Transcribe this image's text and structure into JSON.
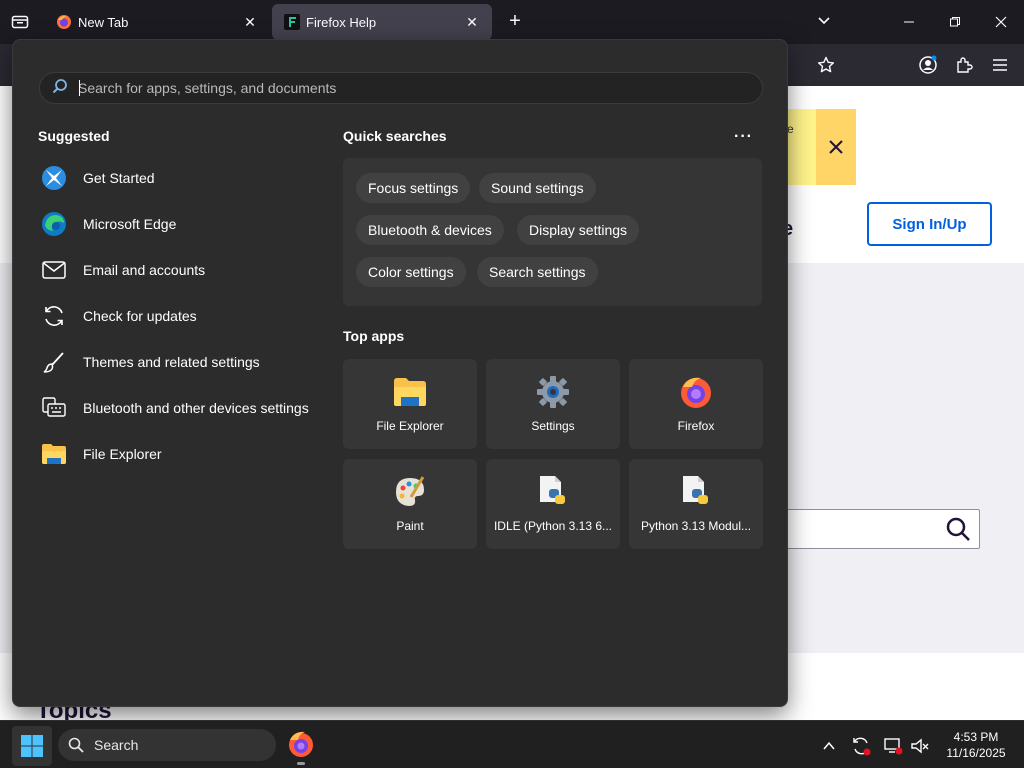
{
  "browser": {
    "tabs": [
      {
        "title": "New Tab"
      },
      {
        "title": "Firefox Help"
      }
    ]
  },
  "page": {
    "sign_in_label": "Sign In/Up",
    "heading_fragment": "e",
    "banner_fragment": "e",
    "topics_label": "Topics"
  },
  "flyout": {
    "search": {
      "placeholder": "Search for apps, settings, and documents",
      "value": ""
    },
    "suggested_title": "Suggested",
    "suggested": [
      {
        "label": "Get Started",
        "icon": "get-started-icon"
      },
      {
        "label": "Microsoft Edge",
        "icon": "edge-icon"
      },
      {
        "label": "Email and accounts",
        "icon": "mail-icon"
      },
      {
        "label": "Check for updates",
        "icon": "sync-icon"
      },
      {
        "label": "Themes and related settings",
        "icon": "brush-icon"
      },
      {
        "label": "Bluetooth and other devices settings",
        "icon": "keyboard-devices-icon"
      },
      {
        "label": "File Explorer",
        "icon": "folder-icon"
      }
    ],
    "quick_searches_title": "Quick searches",
    "quick_searches": [
      "Focus settings",
      "Sound settings",
      "Bluetooth & devices",
      "Display settings",
      "Color settings",
      "Search settings"
    ],
    "top_apps_title": "Top apps",
    "top_apps": [
      {
        "label": "File Explorer",
        "icon": "folder-icon"
      },
      {
        "label": "Settings",
        "icon": "gear-icon"
      },
      {
        "label": "Firefox",
        "icon": "firefox-icon"
      },
      {
        "label": "Paint",
        "icon": "paint-palette-icon"
      },
      {
        "label": "IDLE (Python 3.13 6...",
        "icon": "python-file-icon"
      },
      {
        "label": "Python 3.13 Modul...",
        "icon": "python-file-icon"
      }
    ]
  },
  "taskbar": {
    "search_label": "Search",
    "time": "4:53 PM",
    "date": "11/16/2025"
  },
  "colors": {
    "accent_blue": "#0060df",
    "flyout_bg": "#2c2c2c",
    "banner_yellow": "#fff38a"
  }
}
